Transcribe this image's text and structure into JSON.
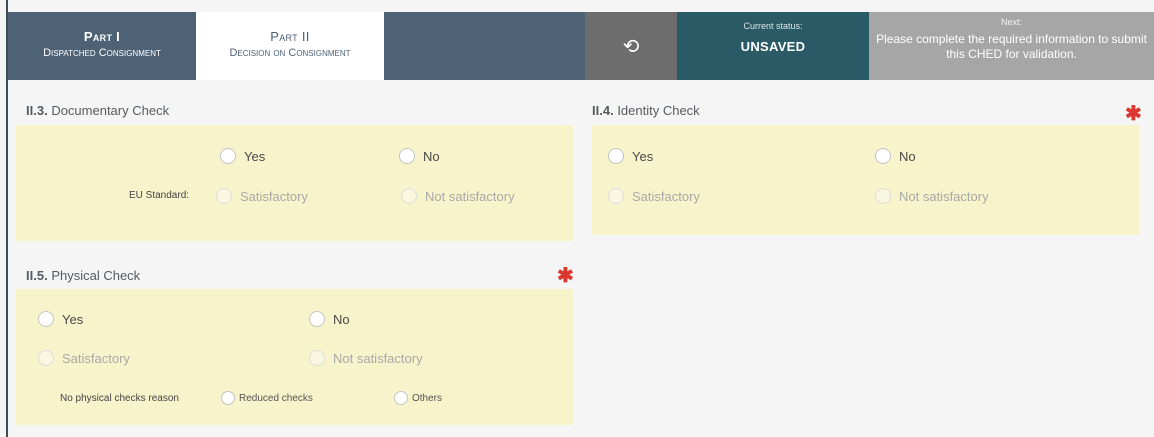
{
  "header": {
    "tabs": [
      {
        "title": "Part I",
        "subtitle": "Dispatched Consignment"
      },
      {
        "title": "Part II",
        "subtitle": "Decision on Consignment"
      }
    ],
    "history_icon": "history-icon",
    "status_label": "Current status:",
    "status_value": "UNSAVED",
    "next_label": "Next:",
    "next_message": "Please complete the required information to submit this CHED for validation."
  },
  "documentary_check": {
    "number": "II.3.",
    "title": "Documentary Check",
    "yes": "Yes",
    "no": "No",
    "eu_standard_label": "EU Standard:",
    "satisfactory": "Satisfactory",
    "not_satisfactory": "Not satisfactory"
  },
  "identity_check": {
    "number": "II.4.",
    "title": "Identity Check",
    "required_mark": "✱",
    "yes": "Yes",
    "no": "No",
    "satisfactory": "Satisfactory",
    "not_satisfactory": "Not satisfactory"
  },
  "physical_check": {
    "number": "II.5.",
    "title": "Physical Check",
    "required_mark": "✱",
    "yes": "Yes",
    "no": "No",
    "satisfactory": "Satisfactory",
    "not_satisfactory": "Not satisfactory",
    "no_checks_reason_label": "No physical checks reason",
    "reduced_checks": "Reduced checks",
    "others": "Others"
  },
  "colors": {
    "header_bg": "#4e6276",
    "status_bg": "#2a5a66",
    "next_bg": "#a6a6a6",
    "panel_bg": "#f7f3cb",
    "required": "#d9372f"
  }
}
